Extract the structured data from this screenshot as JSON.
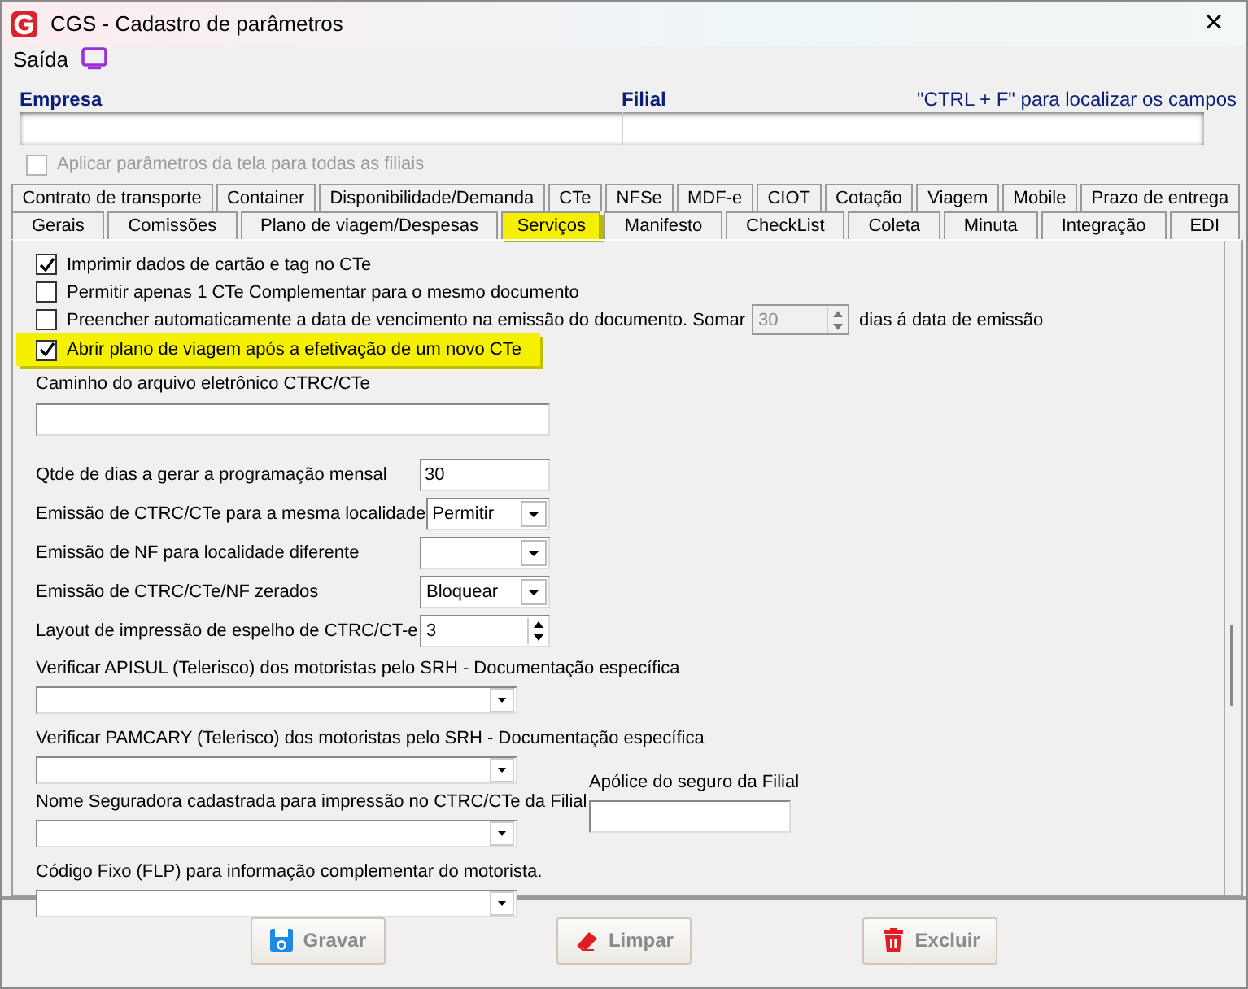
{
  "window": {
    "title": "CGS - Cadastro de parâmetros",
    "close": "×"
  },
  "menu": [
    {
      "label": "Saída"
    }
  ],
  "header": {
    "empresa_label": "Empresa",
    "filial_label": "Filial",
    "hint": "\"CTRL + F\" para localizar os campos"
  },
  "apply_all": {
    "label": "Aplicar parâmetros da tela para todas as filiais",
    "checked": false,
    "disabled": true
  },
  "tab_rows": [
    [
      {
        "label": "Contrato de transporte",
        "selected": false
      },
      {
        "label": "Container",
        "selected": false
      },
      {
        "label": "Disponibilidade/Demanda",
        "selected": false
      },
      {
        "label": "CTe",
        "selected": false
      },
      {
        "label": "NFSe",
        "selected": false
      },
      {
        "label": "MDF-e",
        "selected": false
      },
      {
        "label": "CIOT",
        "selected": false
      },
      {
        "label": "Cotação",
        "selected": false
      },
      {
        "label": "Viagem",
        "selected": false
      },
      {
        "label": "Mobile",
        "selected": false
      },
      {
        "label": "Prazo de entrega",
        "selected": false
      }
    ],
    [
      {
        "label": "Gerais",
        "selected": false
      },
      {
        "label": "Comissões",
        "selected": false
      },
      {
        "label": "Plano de viagem/Despesas",
        "selected": false
      },
      {
        "label": "Serviços",
        "selected": true
      },
      {
        "label": "Manifesto",
        "selected": false
      },
      {
        "label": "CheckList",
        "selected": false
      },
      {
        "label": "Coleta",
        "selected": false
      },
      {
        "label": "Minuta",
        "selected": false
      },
      {
        "label": "Integração",
        "selected": false
      },
      {
        "label": "EDI",
        "selected": false
      }
    ]
  ],
  "options": [
    {
      "label": "Imprimir dados de cartão e tag no CTe",
      "checked": true,
      "highlighted": false
    },
    {
      "label": "Permitir apenas 1 CTe Complementar para o mesmo documento",
      "checked": false,
      "highlighted": false
    },
    {
      "label": "Preencher automaticamente a data de vencimento na emissão do documento. Somar",
      "checked": false,
      "highlighted": false,
      "spin_value": "30",
      "suffix": "dias á data de emissão"
    },
    {
      "label": "Abrir plano de viagem após a efetivação de um novo CTe",
      "checked": true,
      "highlighted": true
    }
  ],
  "path_field": {
    "label": "Caminho do arquivo eletrônico CTRC/CTe"
  },
  "inline_fields": [
    {
      "label": "Qtde de dias a gerar a programação mensal",
      "kind": "text",
      "value": "30"
    },
    {
      "label": "Emissão de CTRC/CTe para a mesma localidade",
      "kind": "select",
      "value": "Permitir"
    },
    {
      "label": "Emissão de NF para localidade diferente",
      "kind": "select"
    },
    {
      "label": "Emissão de CTRC/CTe/NF zerados",
      "kind": "select",
      "value": "Bloquear"
    },
    {
      "label": "Layout de impressão de espelho de CTRC/CT-e",
      "kind": "spin",
      "value": "3"
    }
  ],
  "stacked_fields": [
    {
      "label": "Verificar APISUL (Telerisco) dos motoristas pelo SRH - Documentação específica"
    },
    {
      "label": "Verificar PAMCARY (Telerisco) dos motoristas pelo SRH - Documentação específica"
    },
    {
      "label": "Nome Seguradora cadastrada para impressão no CTRC/CTe da Filial"
    },
    {
      "label": "Código Fixo (FLP) para informação complementar do motorista."
    }
  ],
  "policy_field": {
    "label": "Apólice do seguro da Filial"
  },
  "buttons": [
    {
      "label": "Gravar",
      "kind": "save",
      "disabled": true
    },
    {
      "label": "Limpar",
      "kind": "clear",
      "disabled": true
    },
    {
      "label": "Excluir",
      "kind": "delete",
      "disabled": true
    }
  ]
}
